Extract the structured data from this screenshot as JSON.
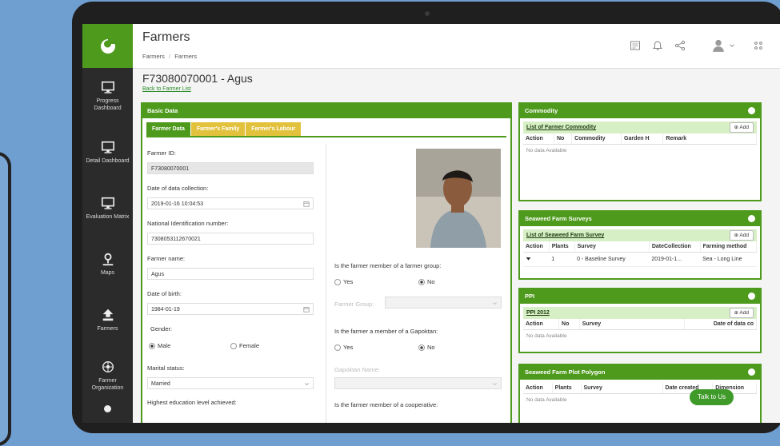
{
  "page": {
    "title": "Farmers",
    "breadcrumb": [
      "Farmers",
      "Farmers"
    ]
  },
  "colors": {
    "accent": "#4e9a1c",
    "tab_inactive": "#e2c23d",
    "sidebar": "#2b2b2b"
  },
  "sidebar": {
    "items": [
      {
        "label": "Progress Dashboard",
        "icon": "monitor-icon"
      },
      {
        "label": "Detail Dashboard",
        "icon": "monitor-icon"
      },
      {
        "label": "Evaluation Matrix",
        "icon": "monitor-icon"
      },
      {
        "label": "Maps",
        "icon": "map-pin-icon"
      },
      {
        "label": "Farmers",
        "icon": "farmer-icon"
      },
      {
        "label": "Farmer Organization",
        "icon": "organization-icon"
      }
    ]
  },
  "header_icons": [
    "document-icon",
    "bell-icon",
    "share-icon",
    "user-avatar-icon",
    "apps-grid-icon"
  ],
  "record": {
    "title": "F73080070001 - Agus",
    "back_link": "Back to Farmer List"
  },
  "basic": {
    "title": "Basic Data",
    "tabs": [
      "Farmer Data",
      "Farmer's Family",
      "Farmer's Labour"
    ],
    "farmer_id": {
      "label": "Farmer ID:",
      "value": "F73080070001"
    },
    "collection_date": {
      "label": "Date of data collection:",
      "value": "2019-01-16 10:04:53"
    },
    "nin": {
      "label": "National Identification number:",
      "value": "7308053112670021"
    },
    "name": {
      "label": "Farmer name:",
      "value": "Agus"
    },
    "dob": {
      "label": "Date of birth:",
      "value": "1984-01-19"
    },
    "gender": {
      "label": "Gender:",
      "male": "Male",
      "female": "Female"
    },
    "marital": {
      "label": "Marital status:",
      "value": "Married"
    },
    "education": {
      "label": "Highest education level achieved:"
    },
    "q_group": "Is the farmer member of a farmer group:",
    "group_field": {
      "label": "Farmer Group:"
    },
    "q_gapoktan": "Is the farmer a member of a Gapoktan:",
    "gapoktan_field": {
      "label": "Gapoktan Name:"
    },
    "q_coop": "Is the farmer member of a cooperative:",
    "yes": "Yes",
    "no": "No"
  },
  "commodity": {
    "title": "Commodity",
    "list_title": "List of Farmer Commodity",
    "add": "Add",
    "columns": [
      "Action",
      "No",
      "Commodity",
      "Garden H",
      "Remark"
    ],
    "empty": "No data Available"
  },
  "surveys": {
    "title": "Seaweed Farm Surveys",
    "list_title": "List of Seaweed Farm Survey",
    "add": "Add",
    "columns": [
      "Action",
      "Plants",
      "Survey",
      "DateCollection",
      "Farming method"
    ],
    "rows": [
      [
        "1",
        "0 - Baseline Survey",
        "2019-01-1...",
        "Sea - Long Line"
      ]
    ]
  },
  "ppi": {
    "title": "PPI",
    "list_title": "PPI 2012",
    "add": "Add",
    "columns": [
      "Action",
      "No",
      "Survey",
      "Date of data co"
    ],
    "empty": "No data Available"
  },
  "polygon": {
    "title": "Seaweed Farm Plot Polygon",
    "columns": [
      "Action",
      "Plants",
      "Survey",
      "Date created",
      "Dimension"
    ],
    "empty": "No data Available"
  },
  "chat": {
    "label": "Talk to Us"
  }
}
